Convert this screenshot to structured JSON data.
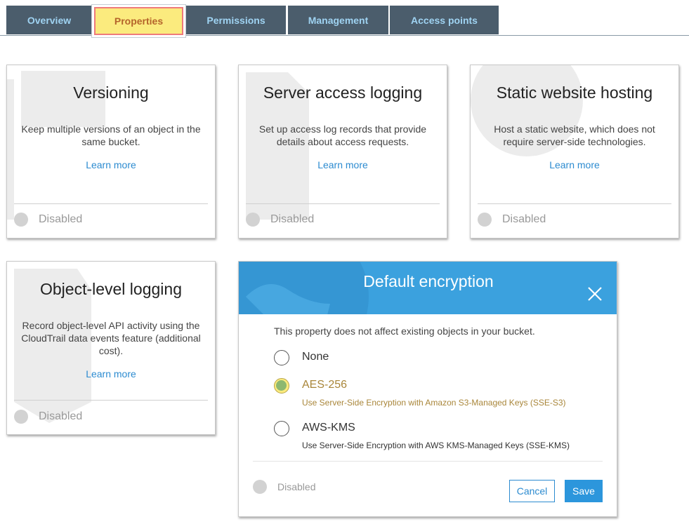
{
  "tabs": [
    {
      "label": "Overview"
    },
    {
      "label": "Properties"
    },
    {
      "label": "Permissions"
    },
    {
      "label": "Management"
    },
    {
      "label": "Access points"
    }
  ],
  "active_tab": "Properties",
  "cards": {
    "versioning": {
      "title": "Versioning",
      "description": "Keep multiple versions of an object in the same bucket.",
      "link": "Learn more",
      "status": "Disabled"
    },
    "server_access_logging": {
      "title": "Server access logging",
      "description": "Set up access log records that provide details about access requests.",
      "link": "Learn more",
      "status": "Disabled"
    },
    "static_website_hosting": {
      "title": "Static website hosting",
      "description": "Host a static website, which does not require server-side technologies.",
      "link": "Learn more",
      "status": "Disabled"
    },
    "object_level_logging": {
      "title": "Object-level logging",
      "description": "Record object-level API activity using the CloudTrail data events feature (additional cost).",
      "link": "Learn more",
      "status": "Disabled"
    }
  },
  "encryption_dialog": {
    "title": "Default encryption",
    "note": "This property does not affect existing objects in your bucket.",
    "options": [
      {
        "label": "None",
        "sublabel": ""
      },
      {
        "label": "AES-256",
        "sublabel": "Use Server-Side Encryption with Amazon S3-Managed Keys (SSE-S3)"
      },
      {
        "label": "AWS-KMS",
        "sublabel": "Use Server-Side Encryption with AWS KMS-Managed Keys (SSE-KMS)"
      }
    ],
    "selected": "AES-256",
    "status": "Disabled",
    "cancel_label": "Cancel",
    "save_label": "Save"
  },
  "colors": {
    "tab_bg": "#4b5d6c",
    "tab_text": "#9fd3f2",
    "highlight": "#fbeb7e",
    "highlight_border": "#ef7b7b",
    "dialog_header": "#3ba1de",
    "link": "#2c8bd0",
    "selected_radio": "#8db870"
  }
}
